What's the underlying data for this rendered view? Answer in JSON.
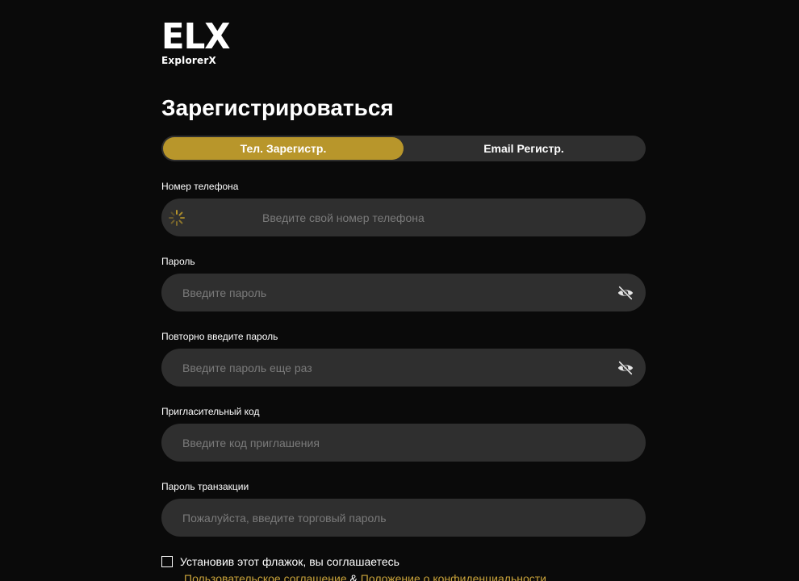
{
  "logo": {
    "mark": "ELX",
    "name": "ExplorerX"
  },
  "page": {
    "title": "Зарегистрироваться"
  },
  "tabs": [
    {
      "label": "Тел. Зарегистр.",
      "active": true
    },
    {
      "label": "Email Регистр.",
      "active": false
    }
  ],
  "form": {
    "phone": {
      "label": "Номер телефона",
      "value": "",
      "placeholder": "Введите свой номер телефона"
    },
    "password": {
      "label": "Пароль",
      "value": "",
      "placeholder": "Введите пароль"
    },
    "password_repeat": {
      "label": "Повторно введите пароль",
      "value": "",
      "placeholder": "Введите пароль еще раз"
    },
    "invite_code": {
      "label": "Пригласительный код",
      "value": "",
      "placeholder": "Введите код приглашения"
    },
    "trade_password": {
      "label": "Пароль транзакции",
      "value": "",
      "placeholder": "Пожалуйста, введите торговый пароль"
    }
  },
  "agreement": {
    "checked": false,
    "text": "Установив этот флажок, вы соглашаетесь",
    "user_agreement": "Пользовательское соглашение",
    "separator": "&",
    "privacy_policy": "Положение о конфиденциальности"
  },
  "icons": {
    "spinner": "loading-spinner-icon",
    "password_toggle": "eye-off-icon"
  },
  "colors": {
    "background": "#0a0a0a",
    "input_bg": "#2f2f2f",
    "accent": "#b8962b",
    "link": "#c9a33a",
    "placeholder": "#7a7a7a",
    "text": "#ffffff"
  }
}
